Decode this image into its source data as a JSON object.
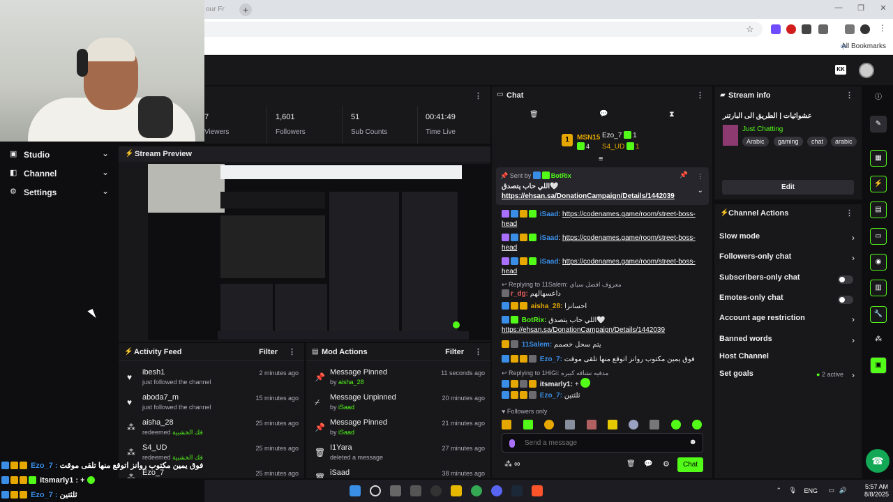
{
  "browser": {
    "tab_title": "our Fr",
    "new_tab": "+",
    "win_min": "—",
    "win_max": "❐",
    "win_close": "✕",
    "all_bookmarks": "All Bookmarks"
  },
  "header": {
    "kick_logo": "KK"
  },
  "nav": {
    "items": [
      {
        "label": "Studio"
      },
      {
        "label": "Channel"
      },
      {
        "label": "Settings"
      }
    ]
  },
  "stats": [
    {
      "value": "7",
      "label": "Viewers"
    },
    {
      "value": "1,601",
      "label": "Followers"
    },
    {
      "value": "51",
      "label": "Sub Counts"
    },
    {
      "value": "00:41:49",
      "label": "Time Live"
    }
  ],
  "preview": {
    "title": "Stream Preview"
  },
  "activity": {
    "title": "Activity Feed",
    "filter": "Filter",
    "rows": [
      {
        "name": "ibesh1",
        "sub": "just followed the channel",
        "time": "2 minutes ago",
        "icon": "heart"
      },
      {
        "name": "aboda7_m",
        "sub": "just followed the channel",
        "time": "15 minutes ago",
        "icon": "heart"
      },
      {
        "name": "aisha_28",
        "sub": "redeemed",
        "extra": "فك الخشبية",
        "time": "25 minutes ago",
        "icon": "points"
      },
      {
        "name": "S4_UD",
        "sub": "redeemed",
        "extra": "فك الخشبية",
        "time": "25 minutes ago",
        "icon": "points"
      },
      {
        "name": "Ezo_7",
        "sub": "",
        "time": "25 minutes ago",
        "icon": "points"
      }
    ]
  },
  "mod": {
    "title": "Mod Actions",
    "filter": "Filter",
    "rows": [
      {
        "name": "Message Pinned",
        "by": "by",
        "user": "aisha_28",
        "time": "11 seconds ago"
      },
      {
        "name": "Message Unpinned",
        "by": "by",
        "user": "iSaad",
        "time": "20 minutes ago"
      },
      {
        "name": "Message Pinned",
        "by": "by",
        "user": "iSaad",
        "time": "21 minutes ago"
      },
      {
        "name": "I1Yara",
        "by": "deleted a message",
        "user": "",
        "time": "27 minutes ago"
      },
      {
        "name": "iSaad",
        "by": "",
        "user": "",
        "time": "38 minutes ago"
      }
    ]
  },
  "chat": {
    "title": "Chat",
    "leaders": {
      "first": "MSN15",
      "first_count": "4",
      "second": "Ezo_7",
      "second_count": "1",
      "third": "S4_UD",
      "third_count": "1",
      "rank": "1"
    },
    "pinned": {
      "sent_by": "Sent by",
      "user": "BotRix",
      "text": "اللي حاب يتصدق🤍",
      "link": "https://ehsan.sa/DonationCampaign/Details/1442039"
    },
    "messages": [
      {
        "user": "iSaad",
        "link": "https://codenames.game/room/street-boss-head"
      },
      {
        "user": "iSaad",
        "link": "https://codenames.game/room/street-boss-head"
      },
      {
        "user": "iSaad",
        "link": "https://codenames.game/room/street-boss-head"
      }
    ],
    "reply1": {
      "label": "Replying to 11Salem:",
      "quote": "معروف افضل سباي",
      "user": "r_dg:",
      "text": "داعسهالهم"
    },
    "m_aisha": {
      "user": "aisha_28:",
      "text": "احسانزا"
    },
    "m_botrix": {
      "user": "BotRix:",
      "text": "اللي حاب يتصدق🤍",
      "link": "https://ehsan.sa/DonationCampaign/Details/1442039"
    },
    "m_salem": {
      "user": "11Salem:",
      "text": "يتم سحل خصمم"
    },
    "m_ezo": {
      "user": "Ezo_7:",
      "text": "فوق يمين مكتوب روانز اتوقع منها تلقى موقت"
    },
    "reply2": {
      "label": "Replying to 1HiGi:",
      "quote": "مدفيه نشافه كبيره",
      "user": "itsmarly1:",
      "text": "+"
    },
    "m_ezo2": {
      "user": "Ezo_7:",
      "text": "ثلثتين"
    },
    "followers_only": "Followers only",
    "placeholder": "Send a message",
    "chat_button": "Chat",
    "infinity": "∞"
  },
  "info": {
    "title": "Stream info",
    "stream_title": "عشوائيات | الطريق الى البارتنر",
    "category": "Just Chatting",
    "tags": [
      "Arabic",
      "gaming",
      "chat",
      "arabic"
    ],
    "edit": "Edit"
  },
  "actions": {
    "title": "Channel Actions",
    "rows": [
      {
        "label": "Slow mode",
        "kind": "chevron"
      },
      {
        "label": "Followers-only chat",
        "kind": "chevron"
      },
      {
        "label": "Subscribers-only chat",
        "kind": "toggle"
      },
      {
        "label": "Emotes-only chat",
        "kind": "toggle"
      },
      {
        "label": "Account age restriction",
        "kind": "chevron"
      },
      {
        "label": "Banned words",
        "kind": "chevron"
      },
      {
        "label": "Host Channel",
        "kind": "none"
      },
      {
        "label": "Set goals",
        "kind": "chevron",
        "extra": "2 active"
      }
    ]
  },
  "overlay": [
    {
      "user": "Ezo_7 :",
      "text": "فوق يمين مكتوب روانز اتوقع منها تلقى موقت"
    },
    {
      "user": "itsmarly1 :",
      "text": "+"
    },
    {
      "user": "Ezo_7 :",
      "text": "ثلثتين"
    }
  ],
  "taskbar": {
    "lang": "ENG",
    "time": "5:57 AM",
    "date": "8/8/2025"
  },
  "colors": {
    "accent": "#53fc18",
    "bg": "#0e0e10",
    "panel": "#18181b",
    "mod_blue": "#3a8ee6",
    "gold": "#e6a800"
  }
}
